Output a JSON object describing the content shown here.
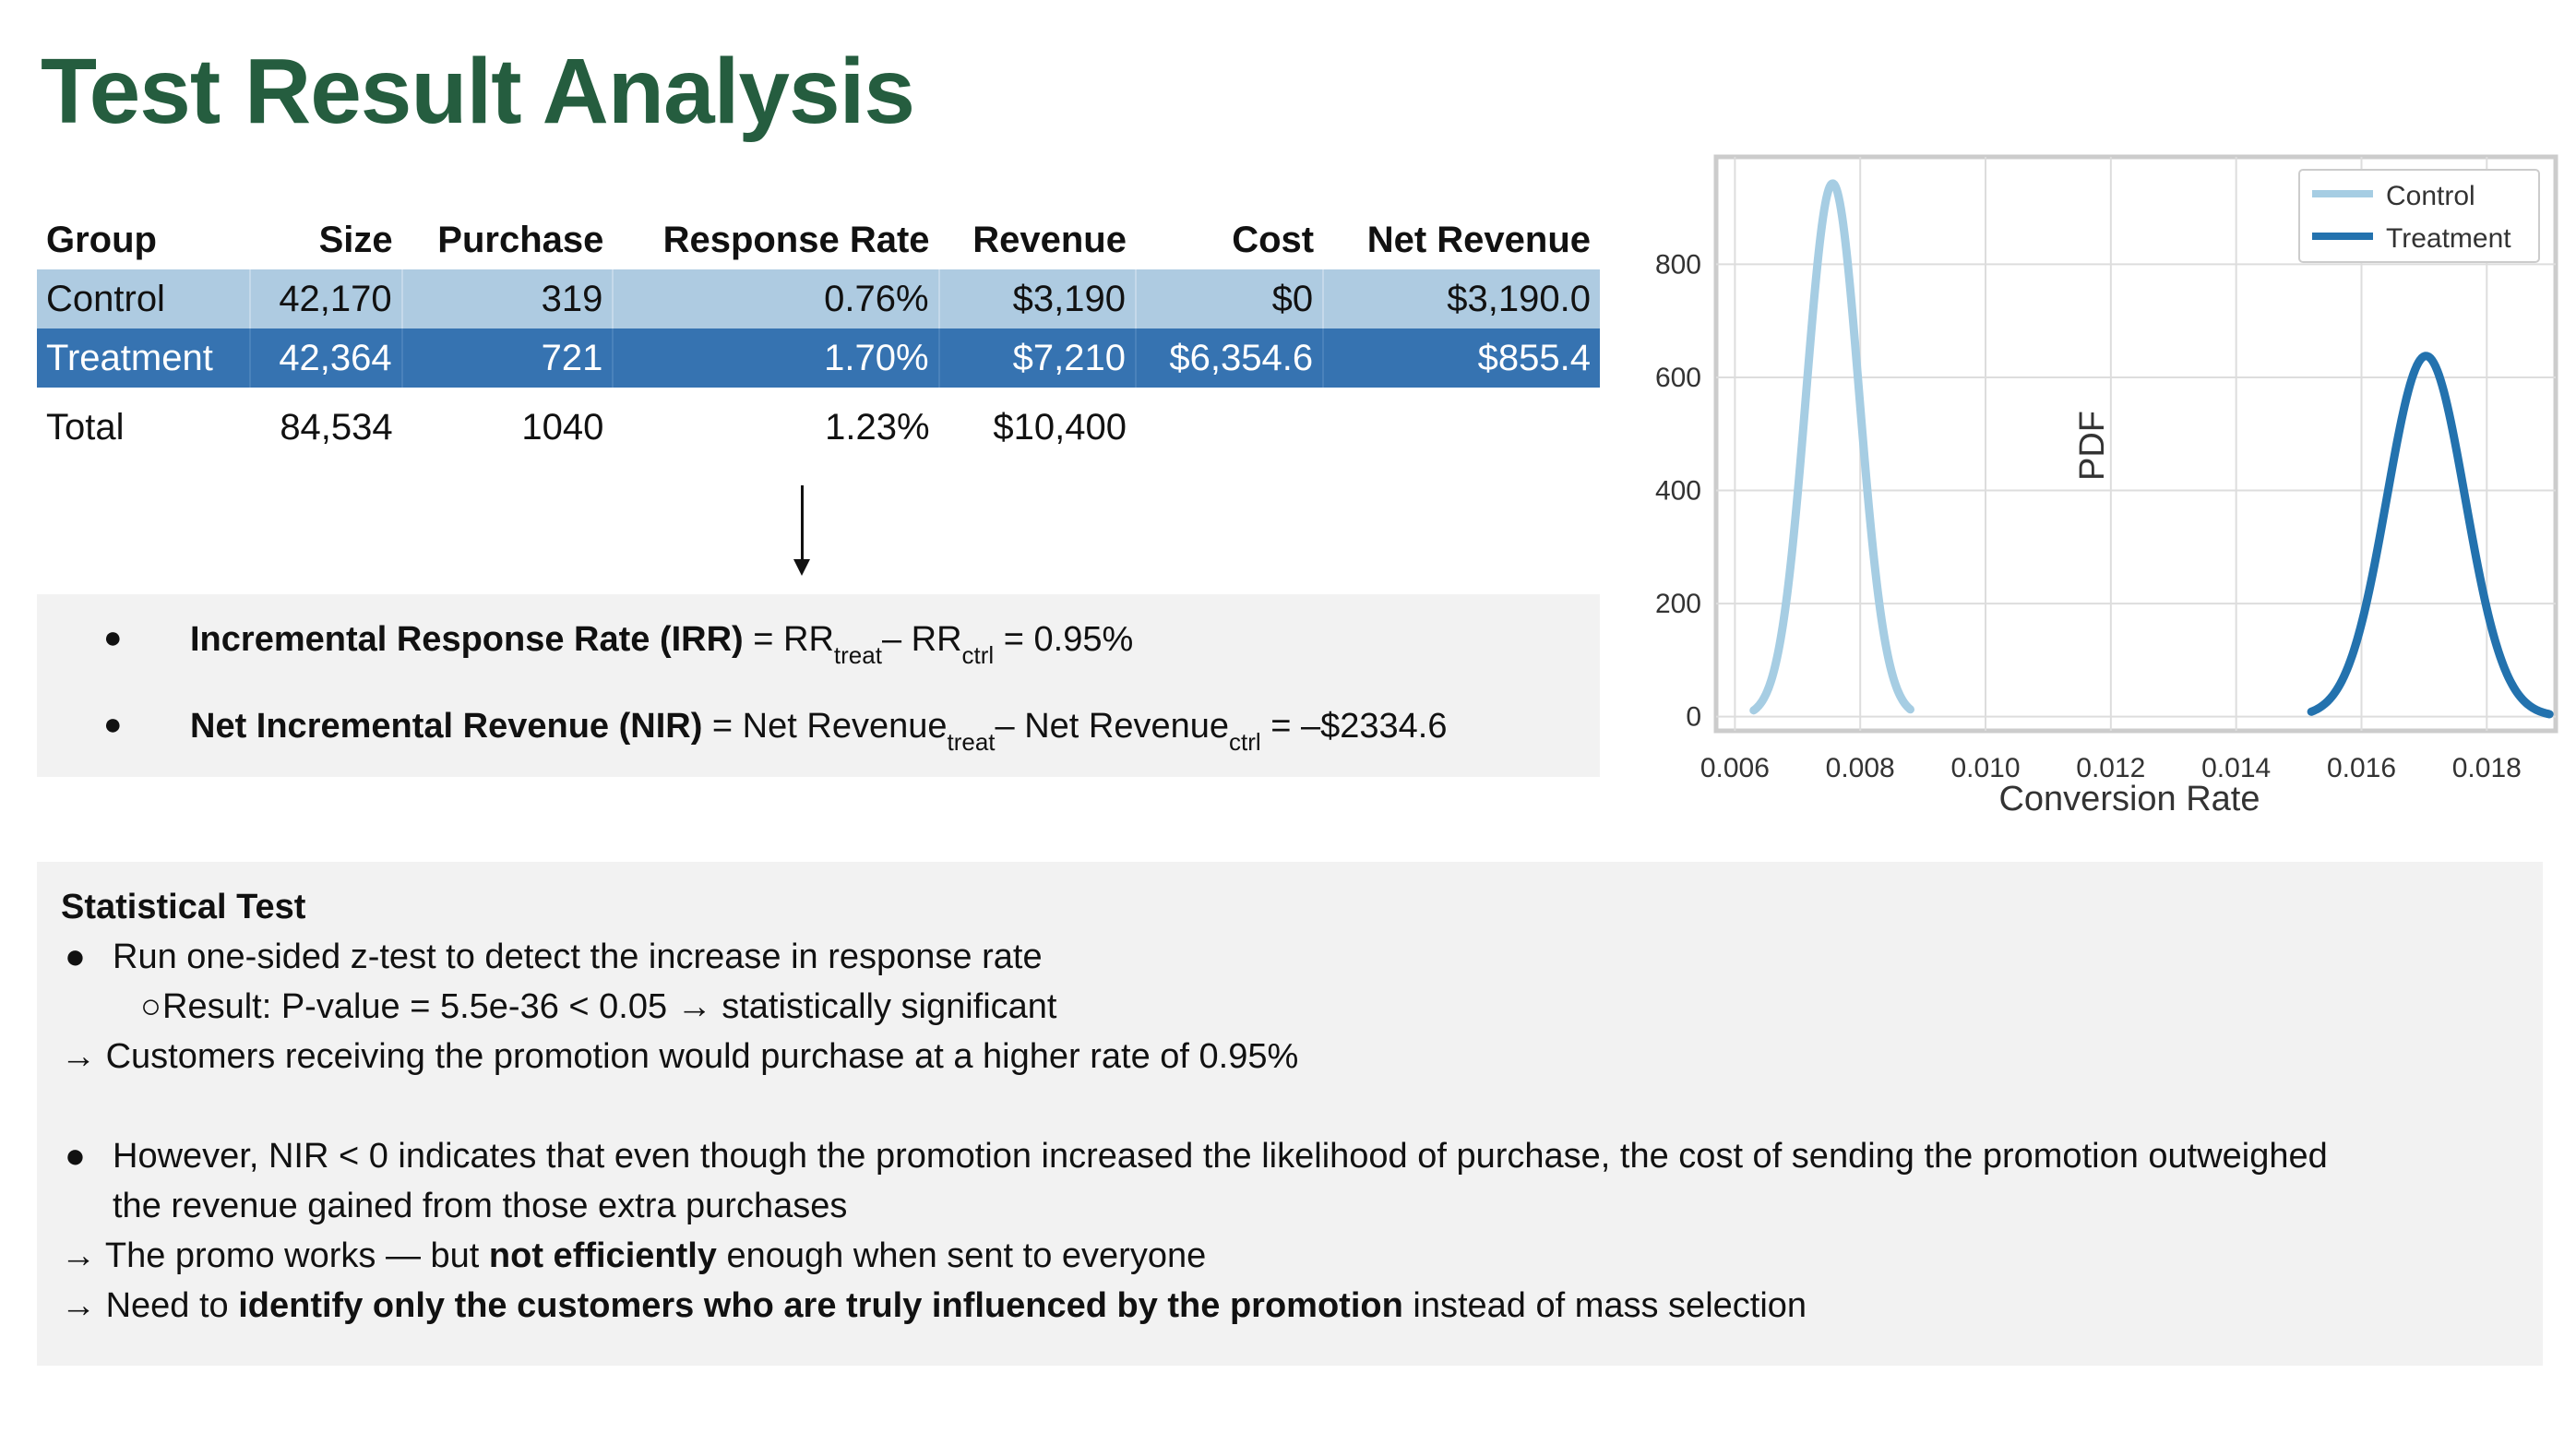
{
  "title": "Test Result Analysis",
  "table": {
    "headers": [
      "Group",
      "Size",
      "Purchase",
      "Response Rate",
      "Revenue",
      "Cost",
      "Net Revenue"
    ],
    "rows": [
      [
        "Control",
        "42,170",
        "319",
        "0.76%",
        "$3,190",
        "$0",
        "$3,190.0"
      ],
      [
        "Treatment",
        "42,364",
        "721",
        "1.70%",
        "$7,210",
        "$6,354.6",
        "$855.4"
      ],
      [
        "Total",
        "84,534",
        "1040",
        "1.23%",
        "$10,400",
        "",
        ""
      ]
    ],
    "colors": {
      "control_row": "#aecbe1",
      "treatment_row": "#3673b1"
    }
  },
  "metrics": {
    "irr": {
      "bullet": "●",
      "name": "Incremental Response Rate (IRR)",
      "eq1": " = RR",
      "sub1": "treat",
      "mid": "– RR",
      "sub2": "ctrl",
      "tail": " = 0.95%"
    },
    "nir": {
      "bullet": "●",
      "name": "Net Incremental Revenue (NIR)",
      "eq1": " = Net Revenue",
      "sub1": "treat",
      "mid": "– Net Revenue",
      "sub2": "ctrl",
      "tail": " = –$2334.6"
    }
  },
  "chart_data": {
    "type": "line",
    "xlabel": "Conversion Rate",
    "ylabel": "PDF",
    "xlim": [
      0.0057,
      0.0191
    ],
    "ylim": [
      -25,
      990
    ],
    "x_ticks": [
      "0.006",
      "0.008",
      "0.010",
      "0.012",
      "0.014",
      "0.016",
      "0.018"
    ],
    "y_ticks": [
      "0",
      "200",
      "400",
      "600",
      "800"
    ],
    "grid": true,
    "legend_position": "top-right",
    "series": [
      {
        "name": "Control",
        "color": "#a6cde3",
        "mean": 0.00756,
        "sd": 0.000423,
        "peak": 943,
        "x_range": [
          0.0063,
          0.0088
        ],
        "x": [
          0.0063,
          0.0066,
          0.0069,
          0.0072,
          0.00756,
          0.0079,
          0.0082,
          0.0085,
          0.0088
        ],
        "y": [
          26,
          117,
          341,
          741,
          943,
          682,
          303,
          91,
          20
        ]
      },
      {
        "name": "Treatment",
        "color": "#2372ae",
        "mean": 0.01703,
        "sd": 0.000625,
        "peak": 638,
        "x_range": [
          0.0152,
          0.019
        ],
        "x": [
          0.0152,
          0.0157,
          0.0162,
          0.0167,
          0.01703,
          0.0174,
          0.0179,
          0.0184,
          0.019
        ],
        "y": [
          9,
          61,
          241,
          559,
          638,
          534,
          225,
          55,
          4
        ]
      }
    ]
  },
  "stats": {
    "heading": "Statistical Test",
    "bullet": "●",
    "sub_bullet": "○",
    "arrow": "→",
    "l1": "Run one-sided z-test to detect the increase in response rate",
    "l2": "Result: P-value = 5.5e-36 < 0.05 → statistically significant",
    "l3": "Customers receiving the promotion would purchase at a higher rate of 0.95%",
    "l4": "However, NIR < 0 indicates that even though the promotion increased the likelihood of purchase, the cost of sending the promotion outweighed",
    "l5": "the revenue gained from those extra purchases",
    "l6_a": "The promo works — but ",
    "l6_b": "not efficiently",
    "l6_c": " enough when sent to everyone",
    "l7_a": "Need to ",
    "l7_b": "identify only the customers who are truly influenced by the promotion",
    "l7_c": " instead of mass selection"
  }
}
